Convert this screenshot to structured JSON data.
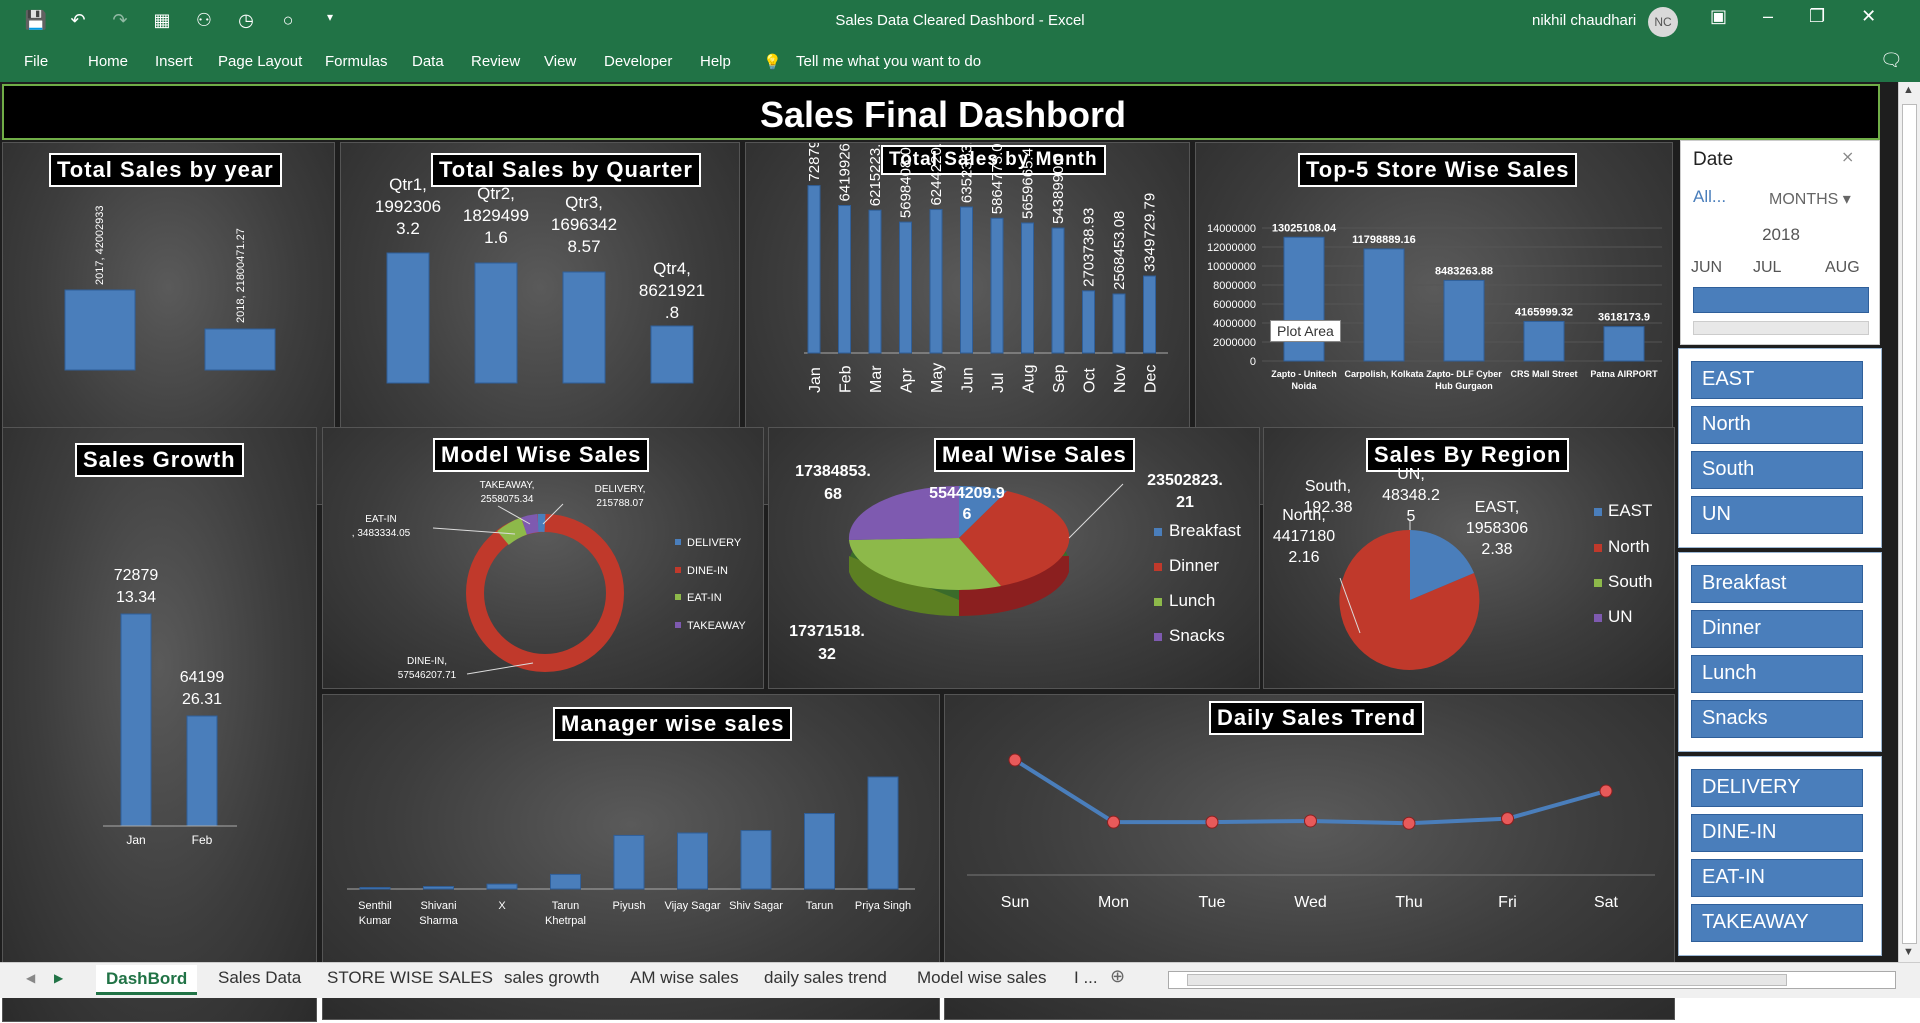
{
  "window": {
    "title": "Sales Data Cleared Dashbord  -  Excel",
    "user": "nikhil chaudhari",
    "avatar": "NC"
  },
  "ribbon": {
    "file": "File",
    "home": "Home",
    "insert": "Insert",
    "page_layout": "Page Layout",
    "formulas": "Formulas",
    "data": "Data",
    "review": "Review",
    "view": "View",
    "developer": "Developer",
    "help": "Help",
    "tellme": "Tell me what you want to do"
  },
  "dashboard": {
    "title": "Sales Final Dashbord"
  },
  "year_chart": {
    "title": "Total Sales by year",
    "labels": [
      "2017, 42002933",
      "2018, 21800471.27"
    ]
  },
  "quarter_chart": {
    "title": "Total Sales by Quarter",
    "labels": [
      [
        "Qtr1,",
        "1992306",
        "3.2"
      ],
      [
        "Qtr2,",
        "1829499",
        "1.6"
      ],
      [
        "Qtr3,",
        "1696342",
        "8.57"
      ],
      [
        "Qtr4,",
        "8621921",
        ".8"
      ]
    ]
  },
  "month_chart": {
    "title": "Total Sales by Month",
    "months": [
      "Jan",
      "Feb",
      "Mar",
      "Apr",
      "May",
      "Jun",
      "Jul",
      "Aug",
      "Sep",
      "Oct",
      "Nov",
      "Dec"
    ],
    "labels": [
      "7287913.34",
      "6419926.31",
      "6215223.55",
      "5698408.0",
      "6244220.",
      "6352363.",
      "5864773.0",
      "5659665.4",
      "5438990.0",
      "2703738.93",
      "2568453.08",
      "3349729.79"
    ]
  },
  "store_chart": {
    "title": "Top-5 Store Wise Sales",
    "yticks": [
      "14000000",
      "12000000",
      "10000000",
      "8000000",
      "6000000",
      "4000000",
      "2000000",
      "0"
    ],
    "stores": [
      [
        "Zapto - Unitech",
        "Noida"
      ],
      [
        "Carpolish, Kolkata"
      ],
      [
        "Zapto- DLF Cyber",
        "Hub Gurgaon"
      ],
      [
        "CRS Mall Street"
      ],
      [
        "Patna AIRPORT"
      ]
    ],
    "labels": [
      "13025108.04",
      "11798889.16",
      "8483263.88",
      "4165999.32",
      "3618173.9"
    ],
    "tooltip": "Plot Area"
  },
  "growth_chart": {
    "title": "Sales Growth",
    "months": [
      "Jan",
      "Feb"
    ],
    "labels": [
      [
        "72879",
        "13.34"
      ],
      [
        "64199",
        "26.31"
      ]
    ]
  },
  "model_chart": {
    "title": "Model Wise Sales",
    "labels": {
      "eatin": [
        "EAT-IN",
        ", 3483334.05"
      ],
      "takeaway": [
        "TAKEAWAY,",
        "2558075.34"
      ],
      "delivery": [
        "DELIVERY,",
        "215788.07"
      ],
      "dinein": [
        "DINE-IN,",
        "57546207.71"
      ]
    },
    "legend": [
      "DELIVERY",
      "DINE-IN",
      "EAT-IN",
      "TAKEAWAY"
    ]
  },
  "meal_chart": {
    "title": "Meal Wise Sales",
    "labels": [
      [
        "17384853.",
        "68"
      ],
      [
        "5544209.9",
        "6"
      ],
      [
        "23502823.",
        "21"
      ],
      [
        "17371518.",
        "32"
      ]
    ],
    "legend": [
      "Breakfast",
      "Dinner",
      "Lunch",
      "Snacks"
    ]
  },
  "region_chart": {
    "title": "Sales By Region",
    "labels": {
      "south": [
        "South,",
        "192.38"
      ],
      "un": [
        "UN,",
        "48348.2",
        "5"
      ],
      "north": [
        "North,",
        "4417180",
        "2.16"
      ],
      "east": [
        "EAST,",
        "1958306",
        "2.38"
      ]
    },
    "legend": [
      "EAST",
      "North",
      "South",
      "UN"
    ]
  },
  "manager_chart": {
    "title": "Manager wise sales",
    "names": [
      [
        "Senthil",
        "Kumar"
      ],
      [
        "Shivani",
        "Sharma"
      ],
      [
        "X"
      ],
      [
        "Tarun",
        "Khetrpal"
      ],
      [
        "Piyush"
      ],
      [
        "Vijay Sagar"
      ],
      [
        "Shiv Sagar"
      ],
      [
        "Tarun"
      ],
      [
        "Priya Singh"
      ]
    ]
  },
  "daily_chart": {
    "title": "Daily Sales Trend",
    "days": [
      "Sun",
      "Mon",
      "Tue",
      "Wed",
      "Thu",
      "Fri",
      "Sat"
    ]
  },
  "date_slicer": {
    "header": "Date",
    "all": "All...",
    "period": "MONTHS",
    "year": "2018",
    "months": [
      "JUN",
      "JUL",
      "AUG"
    ]
  },
  "region_slicer": [
    "EAST",
    "North",
    "South",
    "UN"
  ],
  "meal_slicer": [
    "Breakfast",
    "Dinner",
    "Lunch",
    "Snacks"
  ],
  "model_slicer": [
    "DELIVERY",
    "DINE-IN",
    "EAT-IN",
    "TAKEAWAY"
  ],
  "sheet_tabs": [
    "DashBord",
    "Sales Data",
    "STORE WISE SALES",
    "sales growth",
    "AM wise sales",
    "daily sales trend",
    "Model wise sales",
    "I ..."
  ],
  "chart_data": [
    {
      "type": "bar",
      "title": "Total Sales by year",
      "categories": [
        "2017",
        "2018"
      ],
      "values": [
        42002933,
        21800471.27
      ]
    },
    {
      "type": "bar",
      "title": "Total Sales by Quarter",
      "categories": [
        "Qtr1",
        "Qtr2",
        "Qtr3",
        "Qtr4"
      ],
      "values": [
        19923063.2,
        18294991.6,
        16963428.57,
        8621921.8
      ]
    },
    {
      "type": "bar",
      "title": "Total Sales by Month",
      "categories": [
        "Jan",
        "Feb",
        "Mar",
        "Apr",
        "May",
        "Jun",
        "Jul",
        "Aug",
        "Sep",
        "Oct",
        "Nov",
        "Dec"
      ],
      "values": [
        7287913.34,
        6419926.31,
        6215223.55,
        5698408,
        6244220,
        6352363,
        5864773,
        5659665.4,
        5438990,
        2703738.93,
        2568453.08,
        3349729.79
      ]
    },
    {
      "type": "bar",
      "title": "Top-5 Store Wise Sales",
      "categories": [
        "Zapto - Unitech Noida",
        "Carpolish, Kolkata",
        "Zapto- DLF Cyber Hub Gurgaon",
        "CRS Mall Street",
        "Patna AIRPORT"
      ],
      "values": [
        13025108.04,
        11798889.16,
        8483263.88,
        4165999.32,
        3618173.9
      ],
      "ylim": [
        0,
        14000000
      ]
    },
    {
      "type": "bar",
      "title": "Sales Growth",
      "categories": [
        "Jan",
        "Feb"
      ],
      "values": [
        7287913.34,
        6419926.31
      ]
    },
    {
      "type": "pie",
      "title": "Model Wise Sales",
      "categories": [
        "DELIVERY",
        "DINE-IN",
        "EAT-IN",
        "TAKEAWAY"
      ],
      "values": [
        215788.07,
        57546207.71,
        3483334.05,
        2558075.34
      ]
    },
    {
      "type": "pie",
      "title": "Meal Wise Sales",
      "categories": [
        "Breakfast",
        "Dinner",
        "Lunch",
        "Snacks"
      ],
      "values": [
        5544209.96,
        23502823.21,
        17371518.32,
        17384853.68
      ]
    },
    {
      "type": "pie",
      "title": "Sales By Region",
      "categories": [
        "EAST",
        "North",
        "South",
        "UN"
      ],
      "values": [
        19583062.38,
        44171802.16,
        192.38,
        48348.25
      ]
    },
    {
      "type": "bar",
      "title": "Manager wise sales",
      "categories": [
        "Senthil Kumar",
        "Shivani Sharma",
        "X",
        "Tarun Khetrpal",
        "Piyush",
        "Vijay Sagar",
        "Shiv Sagar",
        "Tarun",
        "Priya Singh"
      ],
      "values": [
        0.3,
        0.5,
        1,
        3,
        11,
        11.5,
        12,
        15.5,
        23
      ]
    },
    {
      "type": "line",
      "title": "Daily Sales Trend",
      "categories": [
        "Sun",
        "Mon",
        "Tue",
        "Wed",
        "Thu",
        "Fri",
        "Sat"
      ],
      "values": [
        100,
        46,
        46,
        47,
        45,
        49,
        73
      ]
    }
  ]
}
